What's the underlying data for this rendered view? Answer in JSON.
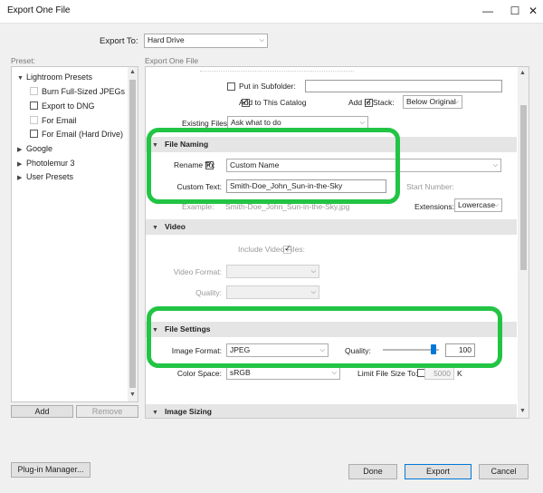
{
  "window": {
    "title": "Export One File",
    "minimize_glyph": "—",
    "maximize_glyph": "☐",
    "close_glyph": "✕"
  },
  "export_to": {
    "label": "Export To:",
    "value": "Hard Drive"
  },
  "preset": {
    "label": "Preset:",
    "items": [
      {
        "label": "Lightroom Presets"
      },
      {
        "label": "Burn Full-Sized JPEGs"
      },
      {
        "label": "Export to DNG"
      },
      {
        "label": "For Email"
      },
      {
        "label": "For Email (Hard Drive)"
      },
      {
        "label": "Google"
      },
      {
        "label": "Photolemur 3"
      },
      {
        "label": "User Presets"
      }
    ],
    "add_label": "Add",
    "remove_label": "Remove"
  },
  "export_one_file_label": "Export One File",
  "location": {
    "put_in_subfolder_label": "Put in Subfolder:",
    "subfolder_value": "",
    "add_to_catalog_label": "Add to This Catalog",
    "add_to_stack_label": "Add to Stack:",
    "stack_value": "Below Original",
    "existing_files_label": "Existing Files:",
    "existing_files_value": "Ask what to do"
  },
  "file_naming": {
    "header": "File Naming",
    "rename_to_label": "Rename To:",
    "rename_to_value": "Custom Name",
    "custom_text_label": "Custom Text:",
    "custom_text_value": "Smith-Doe_John_Sun-in-the-Sky",
    "start_number_label": "Start Number:",
    "example_label": "Example:",
    "example_value": "Smith-Doe_John_Sun-in-the-Sky.jpg",
    "extensions_label": "Extensions:",
    "extensions_value": "Lowercase"
  },
  "video": {
    "header": "Video",
    "include_video_label": "Include Video Files:",
    "video_format_label": "Video Format:",
    "quality_label": "Quality:"
  },
  "file_settings": {
    "header": "File Settings",
    "image_format_label": "Image Format:",
    "image_format_value": "JPEG",
    "quality_label": "Quality:",
    "quality_value": "100",
    "quality_fraction": 0.95,
    "color_space_label": "Color Space:",
    "color_space_value": "sRGB",
    "limit_file_size_label": "Limit File Size To:",
    "limit_file_size_value": "5000",
    "limit_unit": "K"
  },
  "image_sizing": {
    "header": "Image Sizing"
  },
  "buttons": {
    "plugin_manager": "Plug-in Manager...",
    "done": "Done",
    "export": "Export",
    "cancel": "Cancel"
  },
  "colors": {
    "highlight": "#22c444",
    "section_header": "#e5e5e5",
    "accent": "#0078d7"
  },
  "icons": {
    "expand": "triangle-down-icon",
    "collapse": "triangle-right-icon",
    "dropdown": "chevron-down-icon"
  }
}
